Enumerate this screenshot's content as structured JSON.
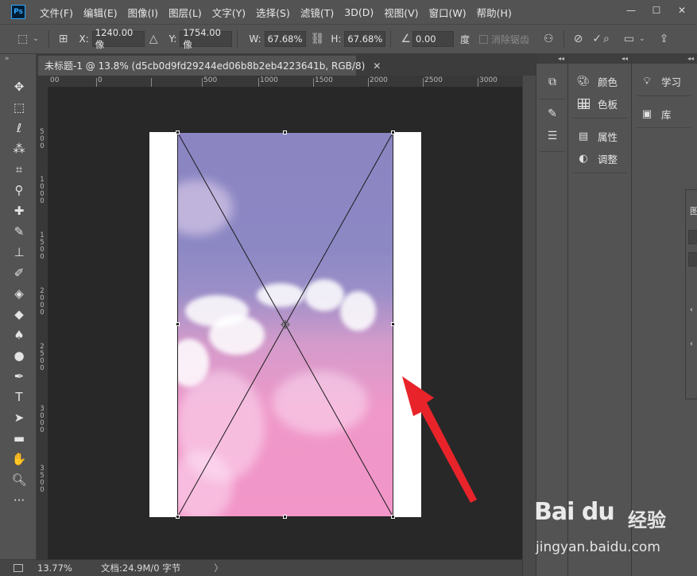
{
  "app": {
    "logo": "Ps"
  },
  "menu": [
    "文件(F)",
    "编辑(E)",
    "图像(I)",
    "图层(L)",
    "文字(Y)",
    "选择(S)",
    "滤镜(T)",
    "3D(D)",
    "视图(V)",
    "窗口(W)",
    "帮助(H)"
  ],
  "window_controls": {
    "minimize": "—",
    "maximize": "☐",
    "close": "✕"
  },
  "options": {
    "x_label": "X:",
    "x_value": "1240.00 像",
    "y_label": "Y:",
    "y_value": "1754.00 像",
    "w_label": "W:",
    "w_value": "67.68%",
    "h_label": "H:",
    "h_value": "67.68%",
    "angle_value": "0.00",
    "angle_unit": "度",
    "antialias_label": "消除锯齿"
  },
  "document": {
    "tab_title": "未标题-1 @ 13.8% (d5cb0d9fd29244ed06b8b2eb4223641b, RGB/8)",
    "close": "✕"
  },
  "ruler_top": [
    "00",
    "0",
    "500",
    "1000",
    "1500",
    "2000",
    "2500",
    "3000"
  ],
  "ruler_left": [
    [
      "5",
      "0",
      "0"
    ],
    [
      "1",
      "0",
      "0",
      "0"
    ],
    [
      "1",
      "5",
      "0",
      "0"
    ],
    [
      "2",
      "0",
      "0",
      "0"
    ],
    [
      "2",
      "5",
      "0",
      "0"
    ],
    [
      "3",
      "0",
      "0",
      "0"
    ],
    [
      "3",
      "5",
      "0",
      "0"
    ]
  ],
  "status": {
    "zoom": "13.77%",
    "doc": "文档:24.9M/0 字节",
    "arrow": "〉"
  },
  "panels": {
    "col2": [
      {
        "icon": "palette-icon",
        "label": "颜色"
      },
      {
        "icon": "swatches-icon",
        "label": "色板"
      },
      {
        "icon": "properties-icon",
        "label": "属性"
      },
      {
        "icon": "adjustments-icon",
        "label": "调整"
      }
    ],
    "col3": [
      {
        "icon": "lightbulb-icon",
        "label": "学习"
      },
      {
        "icon": "library-icon",
        "label": "库"
      }
    ]
  },
  "float_panel": {
    "text": "图"
  },
  "colors": {
    "foreground": "#b46ee0",
    "background": "#ffffff",
    "annotation_arrow": "#e8232a"
  },
  "watermark": {
    "logo": "Bai du",
    "brand": "经验",
    "url": "jingyan.baidu.com"
  }
}
